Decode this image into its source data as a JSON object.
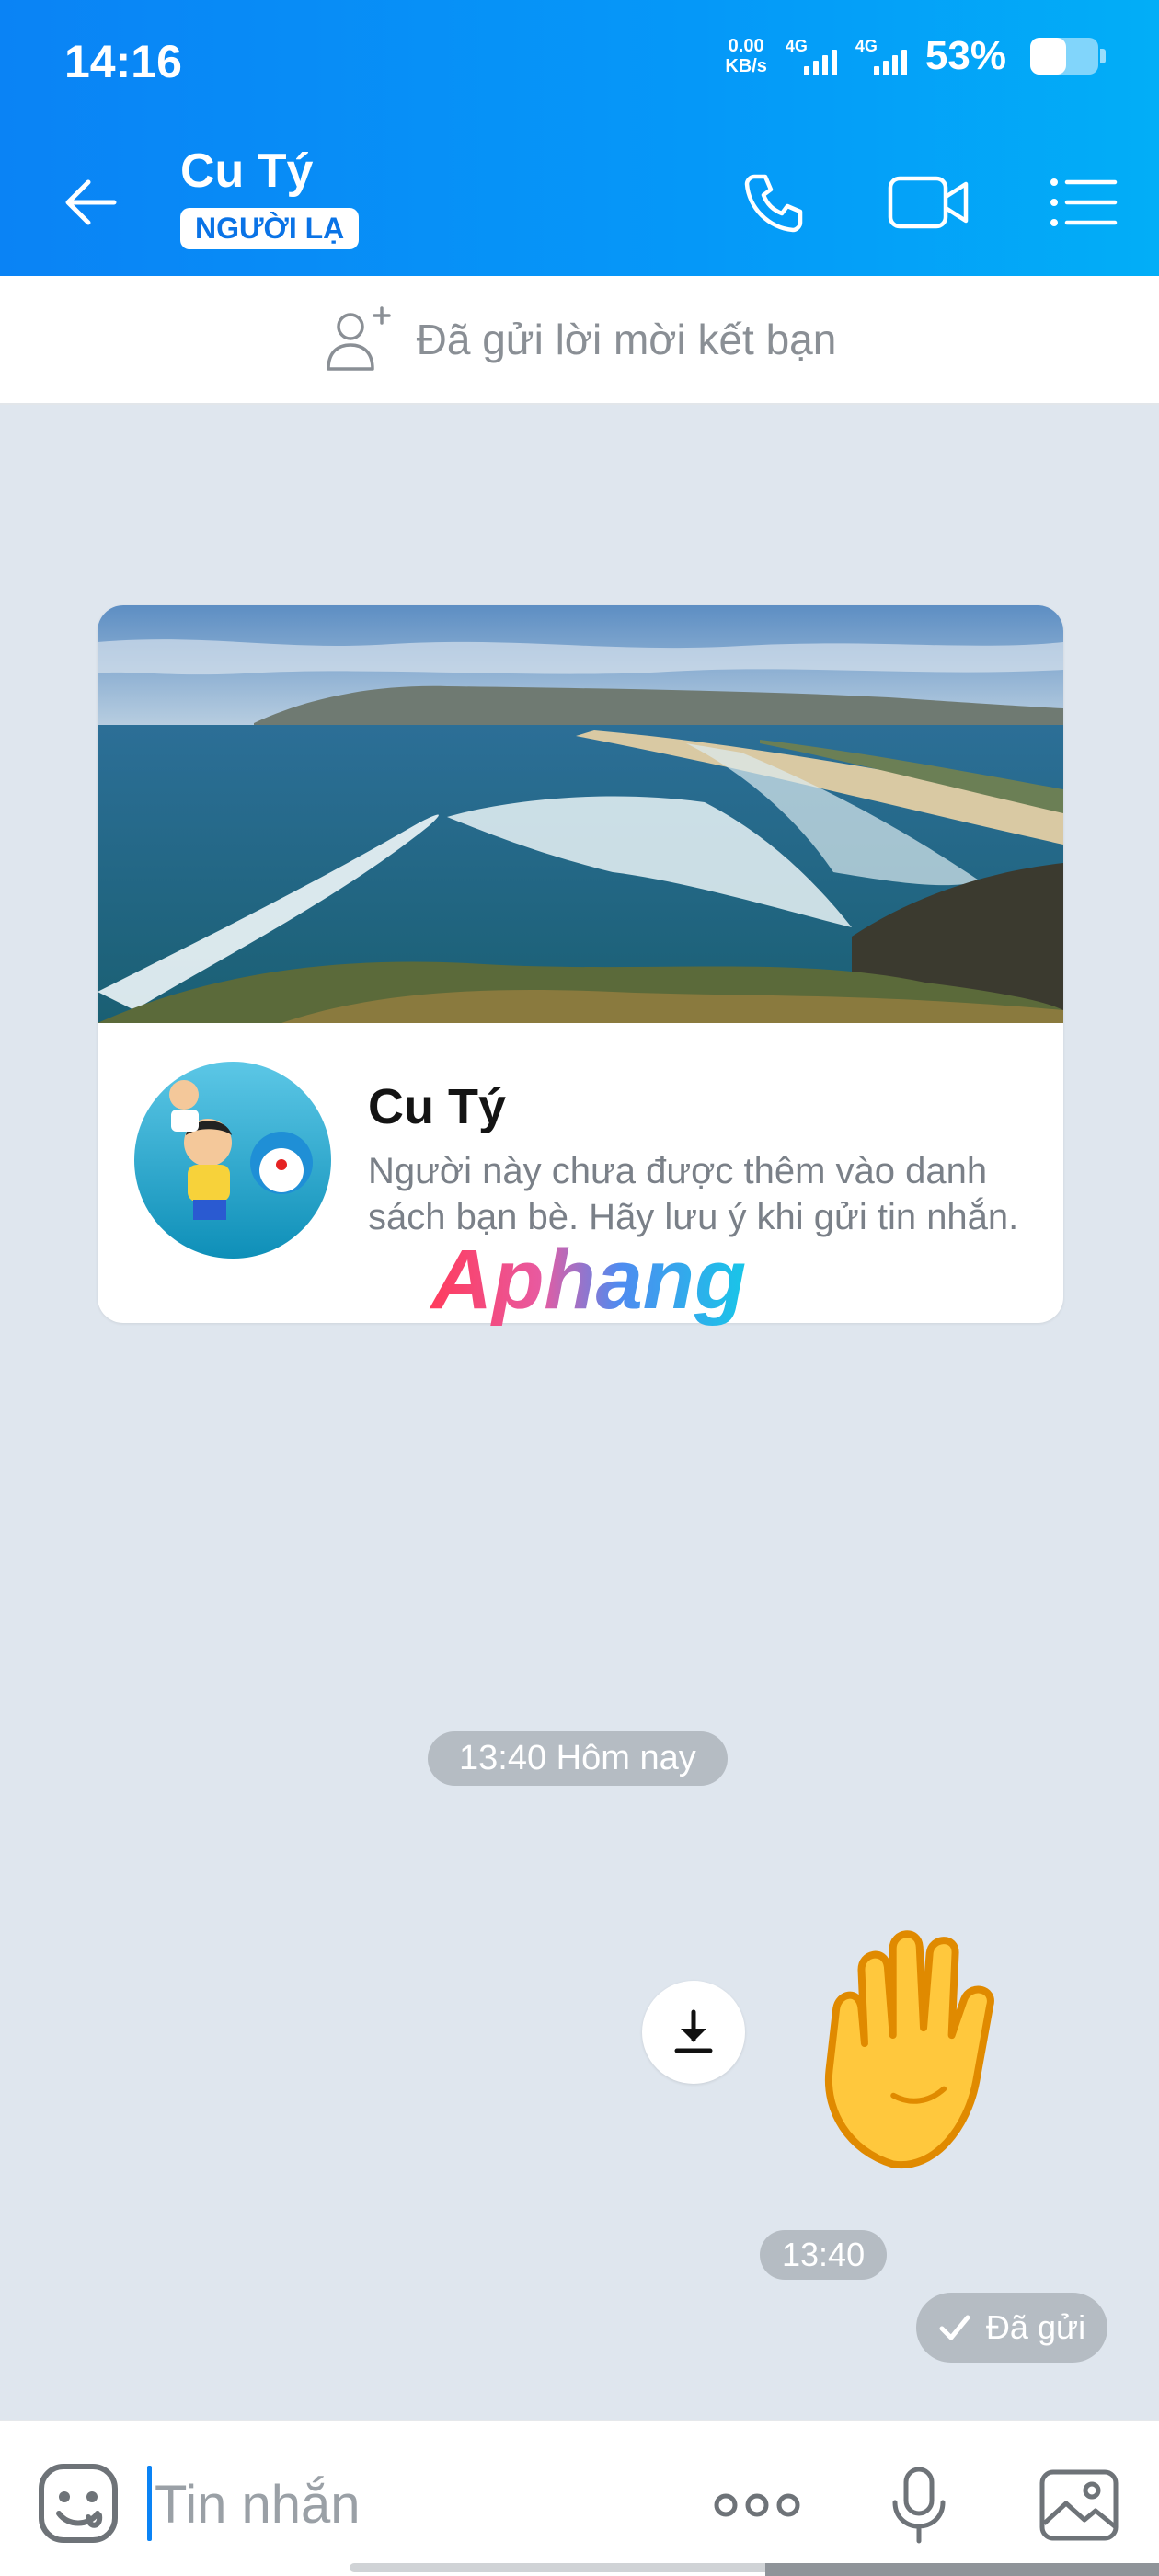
{
  "status_bar": {
    "time": "14:16",
    "net_speed_value": "0.00",
    "net_speed_unit": "KB/s",
    "sim1_network": "4G",
    "sim2_network": "4G",
    "battery_percent": "53%",
    "battery_level": 0.53
  },
  "header": {
    "contact_name": "Cu Tý",
    "badge": "NGƯỜI LẠ",
    "back_icon": "arrow-left-icon",
    "call_icon": "phone-icon",
    "video_icon": "video-camera-icon",
    "menu_icon": "list-menu-icon",
    "gradient_start": "#0a83f5",
    "gradient_end": "#02aef7"
  },
  "friend_request": {
    "text": "Đã gửi lời mời kết bạn",
    "icon": "add-person-icon"
  },
  "profile_card": {
    "name": "Cu Tý",
    "description": "Người này chưa được thêm vào danh sách bạn bè. Hãy lưu ý khi gửi tin nhắn."
  },
  "watermark": "Aphang",
  "chat": {
    "date_divider": "13:40 Hôm nay",
    "message_time": "13:40",
    "sent_status": "Đã gửi",
    "sticker": "waving-hand-sticker"
  },
  "input_bar": {
    "placeholder": "Tin nhắn",
    "emoji_icon": "emoji-icon",
    "more_icon": "more-icon",
    "mic_icon": "microphone-icon",
    "image_icon": "image-icon"
  }
}
